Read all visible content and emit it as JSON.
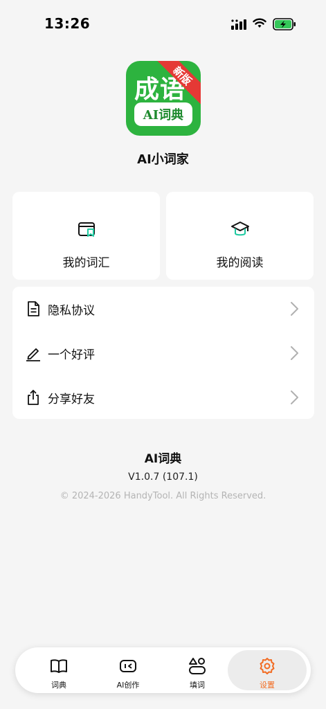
{
  "status_bar": {
    "time": "13:26"
  },
  "app": {
    "icon_title": "成语",
    "icon_badge": "新版",
    "icon_subtitle": "AI词典",
    "name": "AI小词家"
  },
  "cards": [
    {
      "label": "我的词汇",
      "icon": "vocabulary-bookmark-icon"
    },
    {
      "label": "我的阅读",
      "icon": "graduation-cap-icon"
    }
  ],
  "menu": [
    {
      "label": "隐私协议",
      "icon": "document-icon"
    },
    {
      "label": "一个好评",
      "icon": "pencil-icon"
    },
    {
      "label": "分享好友",
      "icon": "share-icon"
    }
  ],
  "about": {
    "name": "AI词典",
    "version": "V1.0.7 (107.1)",
    "copyright": "© 2024-2026 HandyTool. All Rights Reserved."
  },
  "tabs": [
    {
      "label": "词典",
      "icon": "book-icon",
      "active": false
    },
    {
      "label": "AI创作",
      "icon": "ai-create-icon",
      "active": false
    },
    {
      "label": "填词",
      "icon": "fill-word-icon",
      "active": false
    },
    {
      "label": "设置",
      "icon": "settings-gear-icon",
      "active": true
    }
  ],
  "colors": {
    "brand_green": "#2db33f",
    "accent_teal": "#1ec9a0",
    "active_orange": "#f26b21",
    "ribbon_red": "#e53935",
    "battery_green": "#34c759"
  }
}
